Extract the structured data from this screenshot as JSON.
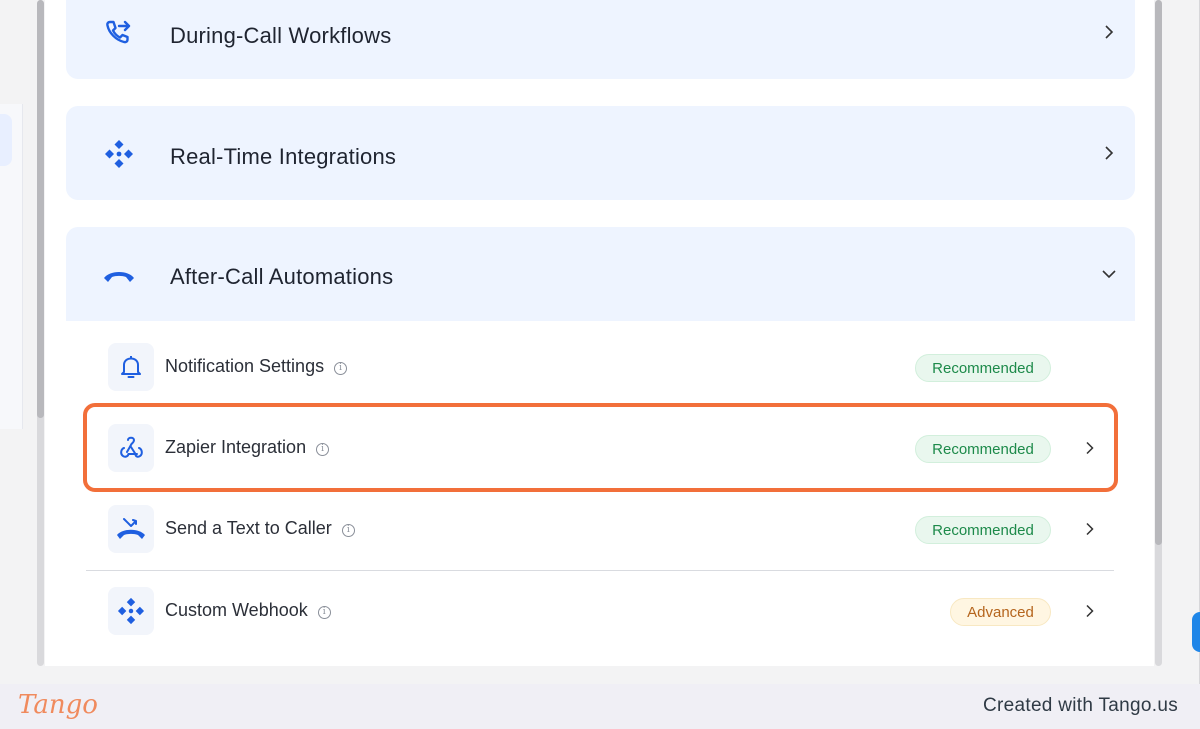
{
  "sections": {
    "during_call": {
      "title": "During-Call Workflows",
      "icon": "phone-forward-icon"
    },
    "real_time": {
      "title": "Real-Time Integrations",
      "icon": "webhook-diamond-icon"
    },
    "after_call": {
      "title": "After-Call Automations",
      "icon": "hangup-icon",
      "expanded": true
    }
  },
  "after_call_items": [
    {
      "label": "Notification Settings",
      "badge": "Recommended",
      "icon": "bell-icon"
    },
    {
      "label": "Zapier Integration",
      "badge": "Recommended",
      "icon": "zapier-webhook-icon"
    },
    {
      "label": "Send a Text to Caller",
      "badge": "Recommended",
      "icon": "missed-call-icon"
    },
    {
      "label": "Custom Webhook",
      "badge": "Advanced",
      "icon": "webhook-diamond-icon"
    }
  ],
  "colors": {
    "accent": "#1f5fe0",
    "section_bg": "#eef4ff",
    "highlight": "#f26f3a",
    "recommended_text": "#1d8a4a",
    "advanced_text": "#b5651d"
  },
  "footer": {
    "logo": "Tango",
    "credit": "Created with Tango.us"
  }
}
